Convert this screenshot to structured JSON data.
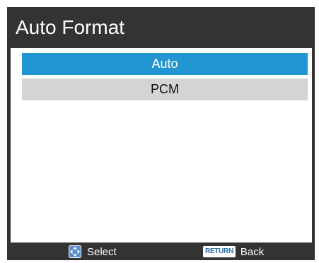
{
  "title": "Auto Format",
  "options": [
    {
      "label": "Auto",
      "selected": true
    },
    {
      "label": "PCM",
      "selected": false
    }
  ],
  "footer": {
    "select": {
      "icon": "dpad-icon",
      "label": "Select"
    },
    "back": {
      "icon": "return-key-icon",
      "key_label": "RETURN",
      "label": "Back"
    }
  },
  "colors": {
    "frame": "#333333",
    "selected_bg": "#2196d3",
    "option_bg": "#d4d4d4",
    "selected_text": "#ffffff",
    "option_text": "#111111"
  }
}
